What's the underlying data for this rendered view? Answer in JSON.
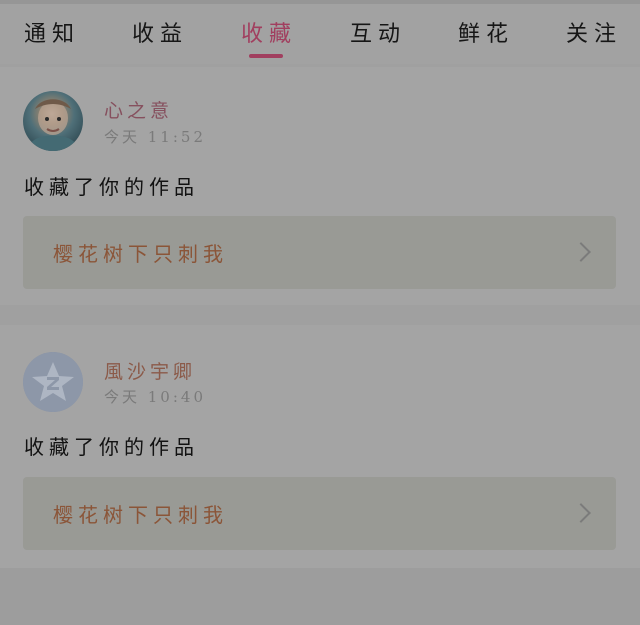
{
  "tabs": [
    {
      "label": "通知"
    },
    {
      "label": "收益"
    },
    {
      "label": "收藏"
    },
    {
      "label": "互动"
    },
    {
      "label": "鲜花"
    },
    {
      "label": "关注"
    }
  ],
  "active_tab": "收藏",
  "notifications": [
    {
      "user_name": "心之意",
      "time": "今天 11:52",
      "action": "收藏了你的作品",
      "work_title": "樱花树下只刺我",
      "avatar": "anime-girl-avatar"
    },
    {
      "user_name": "風沙宇卿",
      "time": "今天 10:40",
      "action": "收藏了你的作品",
      "work_title": "樱花树下只刺我",
      "avatar": "default-qq-avatar"
    }
  ],
  "colors": {
    "accent": "#a13f5f",
    "overlay_background": "#a0a0a0"
  }
}
